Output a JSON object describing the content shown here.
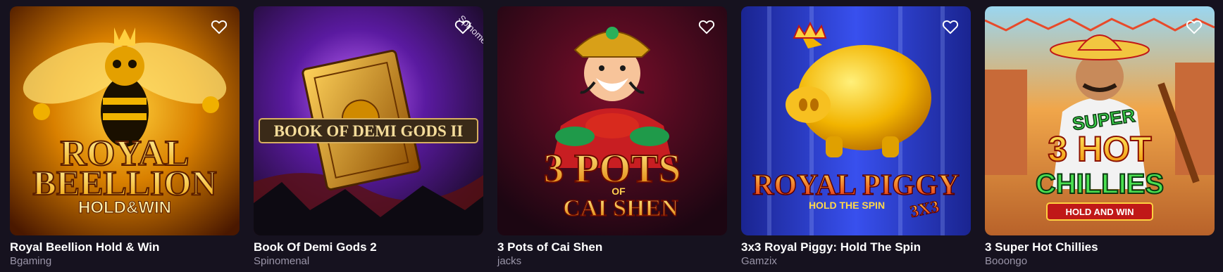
{
  "games": [
    {
      "title": "Royal Beellion Hold & Win",
      "provider": "Bgaming",
      "art_lines": [
        "ROYAL",
        "BEELLION",
        "HOLD&WIN"
      ],
      "accent": "#f5a400"
    },
    {
      "title": "Book Of Demi Gods 2",
      "provider": "Spinomenal",
      "art_lines": [
        "BOOK OF DEMI GODS II"
      ],
      "watermark": "Spinomenal",
      "accent": "#7a2fc4"
    },
    {
      "title": "3 Pots of Cai Shen",
      "provider": "jacks",
      "art_lines": [
        "3 POTS",
        "OF",
        "CAI SHEN"
      ],
      "accent": "#c8141e"
    },
    {
      "title": "3x3 Royal Piggy: Hold The Spin",
      "provider": "Gamzix",
      "art_lines": [
        "ROYAL PIGGY",
        "HOLD THE SPIN",
        "3X3"
      ],
      "accent": "#2b3fd6"
    },
    {
      "title": "3 Super Hot Chillies",
      "provider": "Booongo",
      "art_lines": [
        "SUPER",
        "3 HOT",
        "CHILLIES",
        "HOLD AND WIN"
      ],
      "accent": "#e2781c"
    }
  ],
  "icons": {
    "favorite": "heart-outline-icon"
  }
}
